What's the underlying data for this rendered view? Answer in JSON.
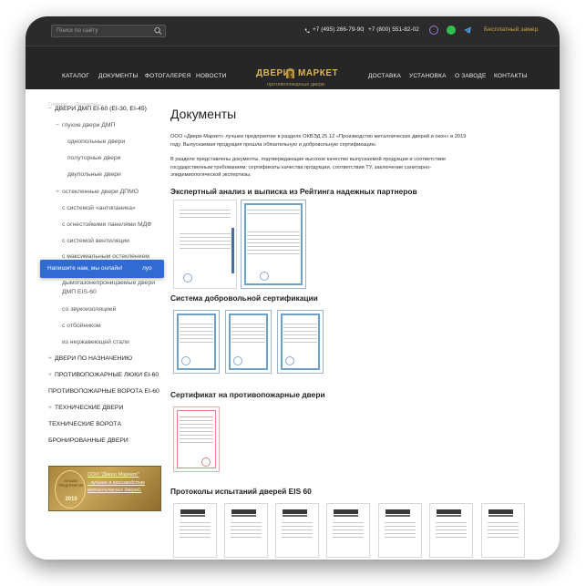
{
  "topbar": {
    "search_placeholder": "Поиск по сайту",
    "phone1": "+7 (495) 266-79-90",
    "separator": "|",
    "phone2": "+7 (800) 551-82-02",
    "measure_link": "Бесплатный замер"
  },
  "nav": {
    "items": [
      "КАТАЛОГ",
      "ДОКУМЕНТЫ",
      "ФОТОГАЛЕРЕЯ",
      "НОВОСТИ",
      "ДОСТАВКА",
      "УСТАНОВКА",
      "О ЗАВОДЕ",
      "КОНТАКТЫ"
    ],
    "logo_left": "ДВЕРИ",
    "logo_right": "МАРКЕТ",
    "logo_sub": "противопожарные двери"
  },
  "breadcrumb": "Главная  →  Документы  →",
  "sidebar": {
    "items": [
      {
        "sign": "−",
        "label": "ДВЕРИ ДМП EI-60 (EI-30, EI-45)"
      },
      {
        "sign": "−",
        "label": "глухие двери ДМП"
      },
      {
        "sign": "",
        "label": "однопольные двери"
      },
      {
        "sign": "",
        "label": "полуторные двери"
      },
      {
        "sign": "",
        "label": "двупольные двери"
      },
      {
        "sign": "+",
        "label": "остекленные двери ДПМО"
      },
      {
        "sign": "",
        "label": "с системой «антипаника»"
      },
      {
        "sign": "",
        "label": "с огнестойкими панелями МДФ"
      },
      {
        "sign": "",
        "label": "с системой вентиляции"
      },
      {
        "sign": "",
        "label": "с максимальным остеклением"
      },
      {
        "sign": "",
        "label": "дымогазонепроницаемые двери"
      },
      {
        "sign": "",
        "label": "ДМП EIS-60"
      },
      {
        "sign": "",
        "label": "со звукоизоляцией"
      },
      {
        "sign": "",
        "label": "с отбойником"
      },
      {
        "sign": "",
        "label": "из нержавеющей стали"
      },
      {
        "sign": "+",
        "label": "ДВЕРИ ПО НАЗНАЧЕНИЮ"
      },
      {
        "sign": "+",
        "label": "ПРОТИВОПОЖАРНЫЕ ЛЮКИ EI-60"
      },
      {
        "sign": "",
        "label": "ПРОТИВОПОЖАРНЫЕ ВОРОТА EI-60"
      },
      {
        "sign": "+",
        "label": "ТЕХНИЧЕСКИЕ ДВЕРИ"
      },
      {
        "sign": "",
        "label": "ТЕХНИЧЕСКИЕ ВОРОТА"
      },
      {
        "sign": "",
        "label": "БРОНИРОВАННЫЕ ДВЕРИ"
      }
    ]
  },
  "chat": {
    "label": "Напишите нам, мы онлайн!",
    "tail": "луо"
  },
  "banner": {
    "seal_line1": "ЛУЧШЕЕ",
    "seal_line2": "ПРЕДПРИЯТИЕ",
    "seal_year": "2019",
    "line1": "ООО \"Двери Маркет\"",
    "line2": "- лучшее в производстве",
    "line3": "металлических дверей."
  },
  "content": {
    "title": "Документы",
    "para1": "ООО «Двери-Маркет» лучшее предприятие в разделе ОКВЭД 25.12 «Производство металлических дверей и окон» в 2019 году. Выпускаемая продукция прошла обязательную и добровольную сертификацию.",
    "para2": "В разделе представлены документы, подтверждающие высокое качество выпускаемой продукции и соответствие государственным требованиям: сертификаты качества продукции, соответствия ТУ, заключение санитарно-эпидемиологической экспертизы.",
    "sections": [
      "Экспертный анализ и выписка из Рейтинга надежных партнеров",
      "Система добровольной сертификации",
      "Сертификат на противопожарные двери",
      "Протоколы испытаний дверей EIS 60"
    ]
  },
  "colors": {
    "topbar_bg": "#2b2b2b",
    "nav_bg": "#262626",
    "gold": "#d7b45a",
    "chat_blue": "#2f6bd0"
  },
  "icons": [
    "search-icon",
    "phone-icon",
    "viber-icon",
    "whatsapp-icon",
    "telegram-icon",
    "door-emblem-icon"
  ]
}
